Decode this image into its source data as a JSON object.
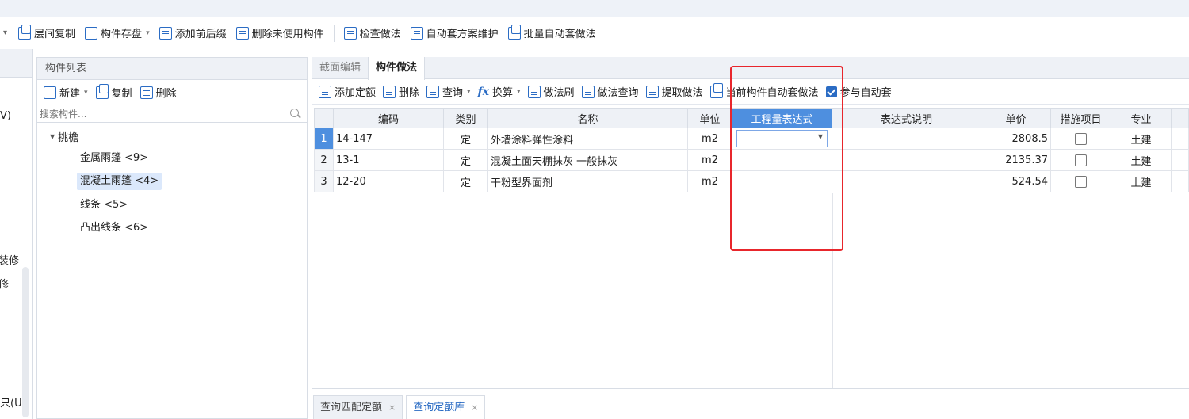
{
  "toolbar": {
    "items": [
      {
        "label": "层间复制",
        "icon": "copy-floor-icon",
        "dropdown": false
      },
      {
        "label": "构件存盘",
        "icon": "save-component-icon",
        "dropdown": true
      },
      {
        "label": "添加前后缀",
        "icon": "add-affix-icon",
        "dropdown": false
      },
      {
        "label": "删除未使用构件",
        "icon": "delete-unused-icon",
        "dropdown": false
      },
      {
        "label": "检查做法",
        "icon": "check-method-icon",
        "dropdown": false
      },
      {
        "label": "自动套方案维护",
        "icon": "auto-scheme-icon",
        "dropdown": false
      },
      {
        "label": "批量自动套做法",
        "icon": "batch-auto-icon",
        "dropdown": false
      }
    ]
  },
  "left_sidebar": {
    "items": [
      "V)",
      "装修",
      "修",
      "只(U"
    ]
  },
  "component_list": {
    "title": "构件列表",
    "tools": {
      "new": "新建",
      "copy": "复制",
      "delete": "删除"
    },
    "search_placeholder": "搜索构件...",
    "tree": {
      "root": "挑檐",
      "children": [
        {
          "label": "金属雨篷 <9>",
          "selected": false
        },
        {
          "label": "混凝土雨篷 <4>",
          "selected": true
        },
        {
          "label": "线条 <5>",
          "selected": false
        },
        {
          "label": "凸出线条 <6>",
          "selected": false
        }
      ]
    }
  },
  "method_panel": {
    "tabs": [
      {
        "label": "截面编辑",
        "active": false
      },
      {
        "label": "构件做法",
        "active": true
      }
    ],
    "tools": {
      "add_quota": "添加定额",
      "delete": "删除",
      "query": "查询",
      "convert": "换算",
      "brush": "做法刷",
      "method_query": "做法查询",
      "extract": "提取做法",
      "current_auto": "当前构件自动套做法",
      "participate": "参与自动套"
    },
    "participate_checked": true,
    "columns": [
      "编码",
      "类别",
      "名称",
      "单位",
      "工程量表达式",
      "表达式说明",
      "单价",
      "措施项目",
      "专业"
    ],
    "rows": [
      {
        "num": "1",
        "code": "14-147",
        "type": "定",
        "name": "外墙涂料弹性涂料",
        "unit": "m2",
        "expr": "",
        "desc": "",
        "price": "2808.5",
        "measure": false,
        "major": "土建"
      },
      {
        "num": "2",
        "code": "13-1",
        "type": "定",
        "name": "混凝土面天棚抹灰 一般抹灰",
        "unit": "m2",
        "expr": "",
        "desc": "",
        "price": "2135.37",
        "measure": false,
        "major": "土建"
      },
      {
        "num": "3",
        "code": "12-20",
        "type": "定",
        "name": "干粉型界面剂",
        "unit": "m2",
        "expr": "",
        "desc": "",
        "price": "524.54",
        "measure": false,
        "major": "土建"
      }
    ]
  },
  "bottom_tabs": [
    {
      "label": "查询匹配定额",
      "active": false
    },
    {
      "label": "查询定额库",
      "active": true
    }
  ],
  "colors": {
    "accent": "#2b6cc4",
    "highlight": "#4e8fdf",
    "annotation_red": "#e8262c",
    "selected_bg": "#dbe8fb"
  }
}
